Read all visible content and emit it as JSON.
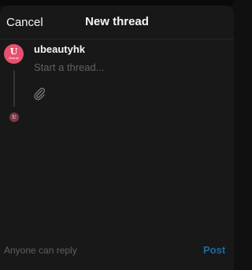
{
  "header": {
    "cancel_label": "Cancel",
    "title": "New thread"
  },
  "composer": {
    "username": "ubeautyhk",
    "placeholder": "Start a thread...",
    "value": "",
    "avatar_logo_mark": "U",
    "avatar_logo_word": "Beauty",
    "avatar_color": "#e8506e",
    "attach_icon": "paperclip-icon"
  },
  "footer": {
    "reply_setting": "Anyone can reply",
    "post_label": "Post",
    "post_color": "#1d6a9e"
  }
}
